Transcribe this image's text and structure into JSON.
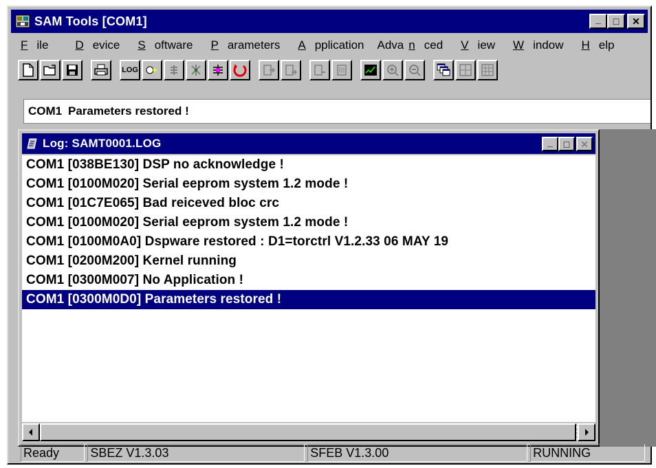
{
  "window": {
    "title": "SAM Tools [COM1]",
    "buttons": {
      "minimize": "_",
      "maximize": "□",
      "close": "✕"
    }
  },
  "menu": {
    "items": [
      "File",
      "Device",
      "Software",
      "Parameters",
      "Application",
      "Advanced",
      "View",
      "Window",
      "Help"
    ]
  },
  "toolbar": {
    "log_label": "LOG",
    "icons": [
      "new-icon",
      "open-icon",
      "save-icon",
      "print-icon",
      "log-icon",
      "device-icon",
      "software-icon",
      "parameters-icon",
      "application-icon",
      "restore-icon",
      "upload-icon",
      "download-icon",
      "compare-icon",
      "print-params-icon",
      "scope-icon",
      "zoom-in-icon",
      "zoom-out-icon",
      "cascade-icon",
      "tile-icon",
      "arrange-icon"
    ]
  },
  "status_line": {
    "port": "COM1",
    "message": "Parameters restored !"
  },
  "log_window": {
    "title": "Log: SAMT0001.LOG",
    "lines": [
      "COM1 [038BE130] DSP no acknowledge !",
      "COM1 [0100M020] Serial eeprom system 1.2 mode !",
      "COM1 [01C7E065] Bad reiceved bloc crc",
      "COM1 [0100M020] Serial eeprom system 1.2 mode !",
      "COM1 [0100M0A0] Dspware restored :  D1=torctrl   V1.2.33   06 MAY 19",
      "COM1 [0200M200] Kernel running",
      "COM1 [0300M007] No Application !",
      "COM1 [0300M0D0] Parameters restored !"
    ],
    "selected_index": 7
  },
  "statusbar": {
    "ready": "Ready",
    "sbez": "SBEZ V1.3.03",
    "sfeb": "SFEB V1.3.00",
    "state": "RUNNING"
  },
  "colors": {
    "titlebar": "#000080",
    "face": "#c0c0c0",
    "selection": "#000080",
    "mdi_background": "#808080"
  }
}
